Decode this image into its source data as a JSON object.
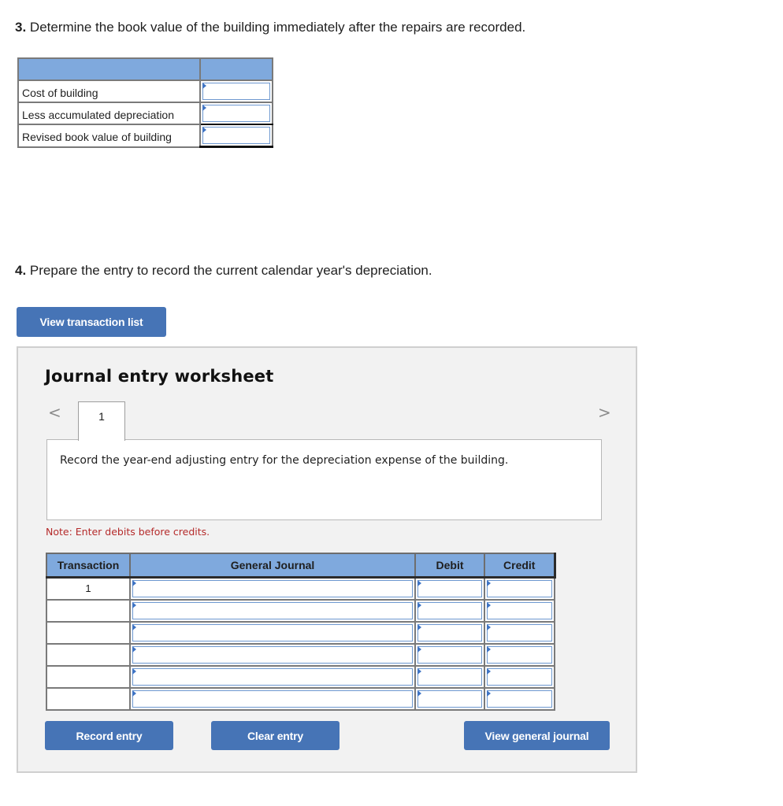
{
  "question3": {
    "number": "3.",
    "text": " Determine the book value of the building immediately after the repairs are recorded.",
    "table": {
      "headers": [
        "",
        ""
      ],
      "rows": [
        {
          "label": "Cost of building",
          "value": ""
        },
        {
          "label": "Less accumulated depreciation",
          "value": ""
        },
        {
          "label": "Revised book value of building",
          "value": ""
        }
      ]
    }
  },
  "question4": {
    "number": "4.",
    "text": " Prepare the entry to record the current calendar year's depreciation."
  },
  "buttons": {
    "view_transaction_list": "View transaction list",
    "record_entry": "Record entry",
    "clear_entry": "Clear entry",
    "view_general_journal": "View general journal"
  },
  "worksheet": {
    "title": "Journal entry worksheet",
    "prev_icon": "<",
    "next_icon": ">",
    "active_tab": "1",
    "description": "Record the year-end adjusting entry for the depreciation expense of the building.",
    "note": "Note: Enter debits before credits.",
    "table": {
      "headers": {
        "transaction": "Transaction",
        "general_journal": "General Journal",
        "debit": "Debit",
        "credit": "Credit"
      },
      "rows": [
        {
          "transaction": "1",
          "account": "",
          "debit": "",
          "credit": ""
        },
        {
          "transaction": "",
          "account": "",
          "debit": "",
          "credit": ""
        },
        {
          "transaction": "",
          "account": "",
          "debit": "",
          "credit": ""
        },
        {
          "transaction": "",
          "account": "",
          "debit": "",
          "credit": ""
        },
        {
          "transaction": "",
          "account": "",
          "debit": "",
          "credit": ""
        },
        {
          "transaction": "",
          "account": "",
          "debit": "",
          "credit": ""
        }
      ]
    }
  },
  "colors": {
    "button_blue": "#4674b6",
    "header_blue": "#7fa9dd",
    "note_red": "#b52b2b",
    "panel_bg": "#f2f2f2"
  }
}
